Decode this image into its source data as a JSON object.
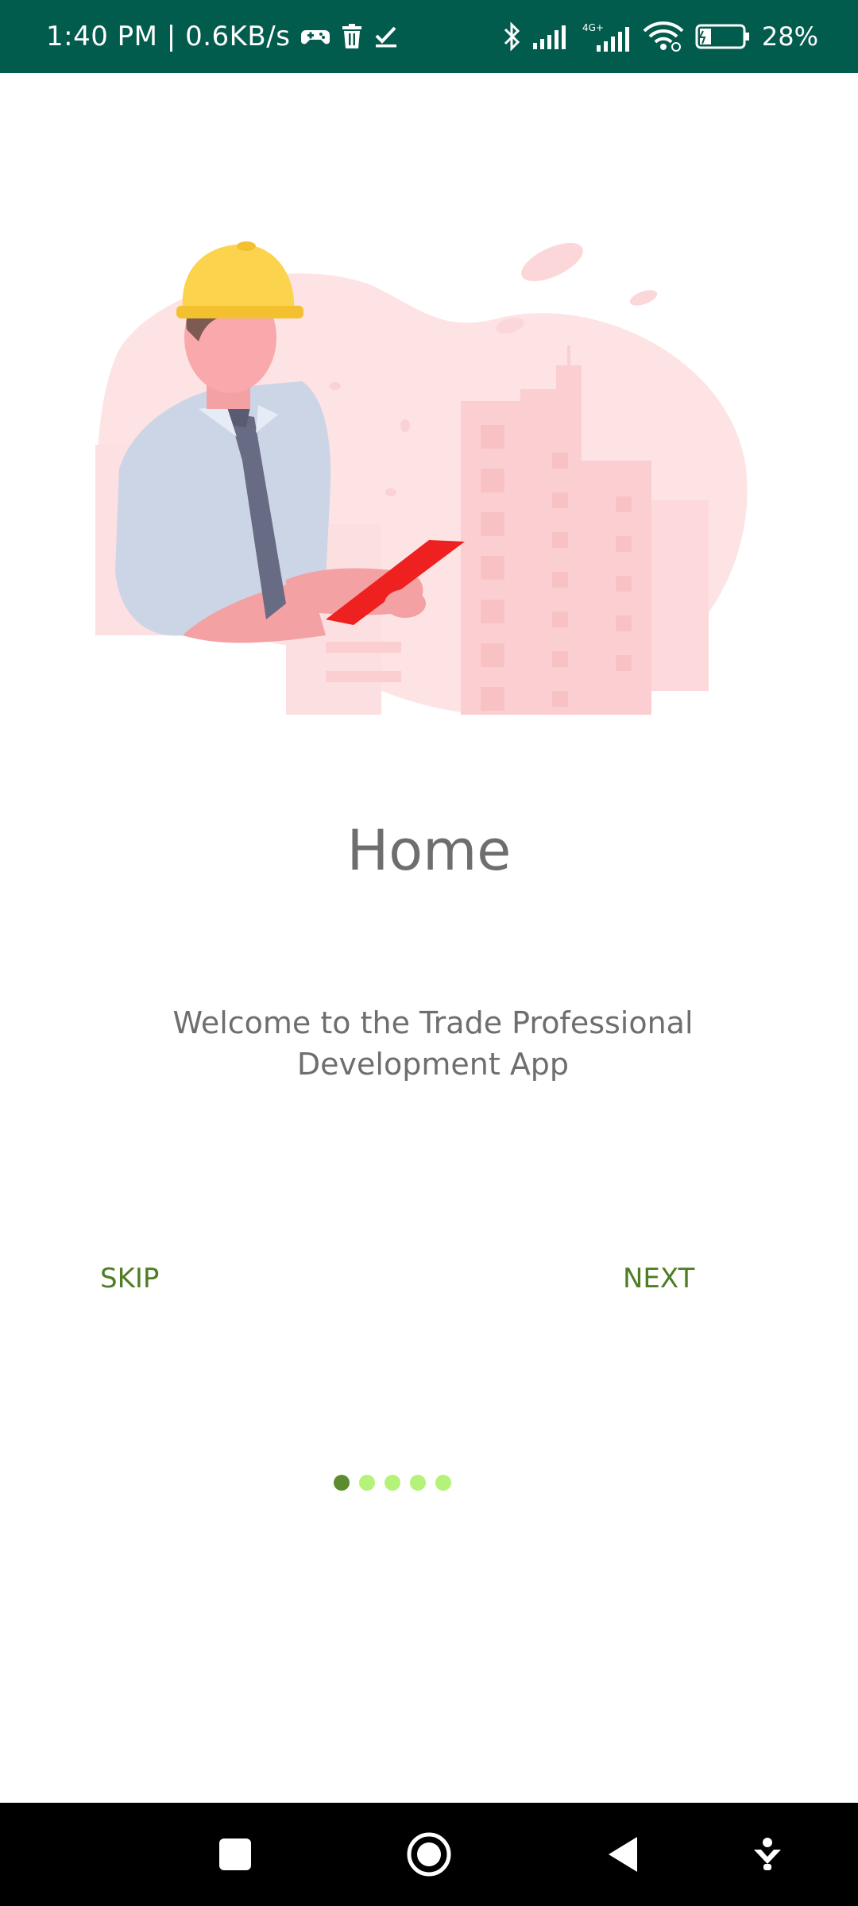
{
  "status_bar": {
    "time": "1:40 PM | 0.6KB/s",
    "battery": "28%",
    "icons": [
      "game-controller-icon",
      "trash-icon",
      "check-icon",
      "bluetooth-icon",
      "signal-icon",
      "signal-4g-icon",
      "wifi-icon",
      "battery-icon"
    ]
  },
  "onboarding": {
    "title": "Home",
    "subtitle": "Welcome to the Trade Professional Development App",
    "skip_label": "SKIP",
    "next_label": "NEXT",
    "page_index": 1,
    "page_count": 5
  },
  "nav_bar": {
    "buttons": [
      "recents-square-icon",
      "home-circle-icon",
      "back-triangle-icon",
      "accessibility-icon"
    ]
  },
  "colors": {
    "status_bar": "#025c4d",
    "accent_green": "#4e7d24",
    "dot_active": "#5b8c2f",
    "dot_inactive": "#b4f27a",
    "text_gray": "#6e6e6e",
    "illustration_blob": "#fde3e4",
    "tablet_red": "#ef2020",
    "helmet_yellow": "#fcd34d"
  }
}
